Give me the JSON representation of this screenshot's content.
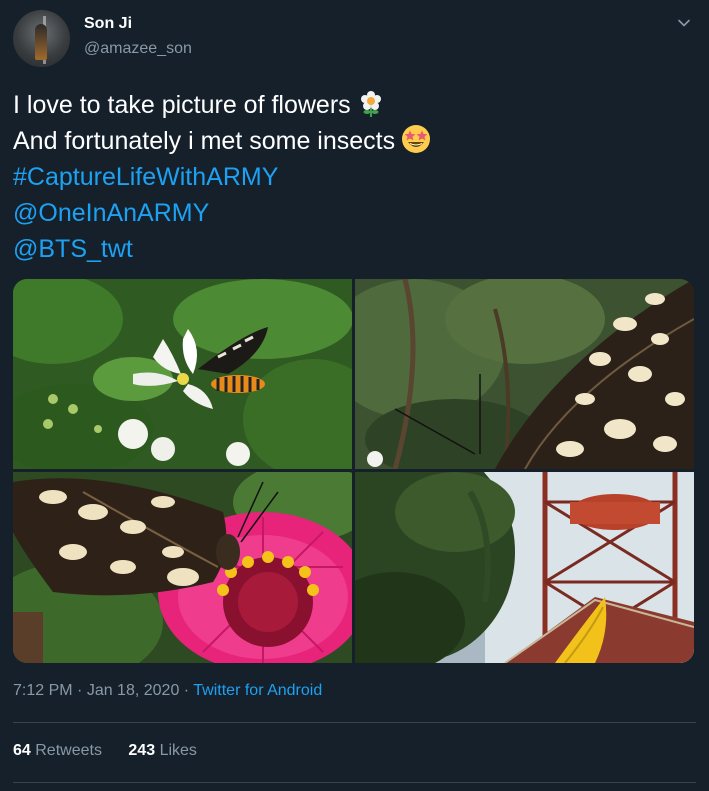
{
  "author": {
    "display_name": "Son Ji",
    "handle": "@amazee_son",
    "avatar_icon": "profile-photo"
  },
  "tweet": {
    "line1": "I love to take picture of flowers",
    "line2": "And fortunately i met some insects",
    "hashtag": "#CaptureLifeWithARMY",
    "mention1": "@OneInAnARMY",
    "mention2": "@BTS_twt",
    "emoji1": "flower-emoji",
    "emoji2": "star-struck-emoji"
  },
  "media": {
    "photos": [
      "moth-on-white-flower",
      "butterfly-wing-closeup",
      "butterfly-on-pink-zinnia",
      "tree-and-water-tower"
    ]
  },
  "meta": {
    "time": "7:12 PM",
    "separator": " · ",
    "date": "Jan 18, 2020",
    "separator2": " · ",
    "source": "Twitter for Android"
  },
  "stats": {
    "retweets_count": "64",
    "retweets_label": "Retweets",
    "likes_count": "243",
    "likes_label": "Likes"
  },
  "colors": {
    "background": "#15202b",
    "link": "#1da1f2",
    "secondary_text": "#8899a6",
    "divider": "#38444d"
  }
}
